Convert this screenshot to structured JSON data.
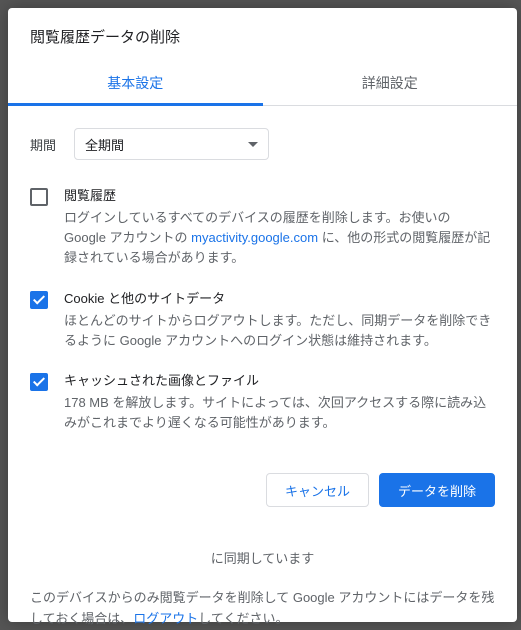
{
  "dialog": {
    "title": "閲覧履歴データの削除",
    "tabs": {
      "basic": "基本設定",
      "advanced": "詳細設定"
    },
    "range": {
      "label": "期間",
      "value": "全期間"
    },
    "items": {
      "history": {
        "title": "閲覧履歴",
        "desc_pre": "ログインしているすべてのデバイスの履歴を削除します。お使いの Google アカウントの ",
        "link": "myactivity.google.com",
        "desc_post": " に、他の形式の閲覧履歴が記録されている場合があります。"
      },
      "cookies": {
        "title": "Cookie と他のサイトデータ",
        "desc": "ほとんどのサイトからログアウトします。ただし、同期データを削除できるように Google アカウントへのログイン状態は維持されます。"
      },
      "cache": {
        "title": "キャッシュされた画像とファイル",
        "desc": "178 MB を解放します。サイトによっては、次回アクセスする際に読み込みがこれまでより遅くなる可能性があります。"
      }
    },
    "buttons": {
      "cancel": "キャンセル",
      "confirm": "データを削除"
    },
    "footer": {
      "sync": "に同期しています",
      "note_pre": "このデバイスからのみ閲覧データを削除して Google アカウントにはデータを残しておく場合は、",
      "logout": "ログアウト",
      "note_post": "してください。"
    }
  }
}
